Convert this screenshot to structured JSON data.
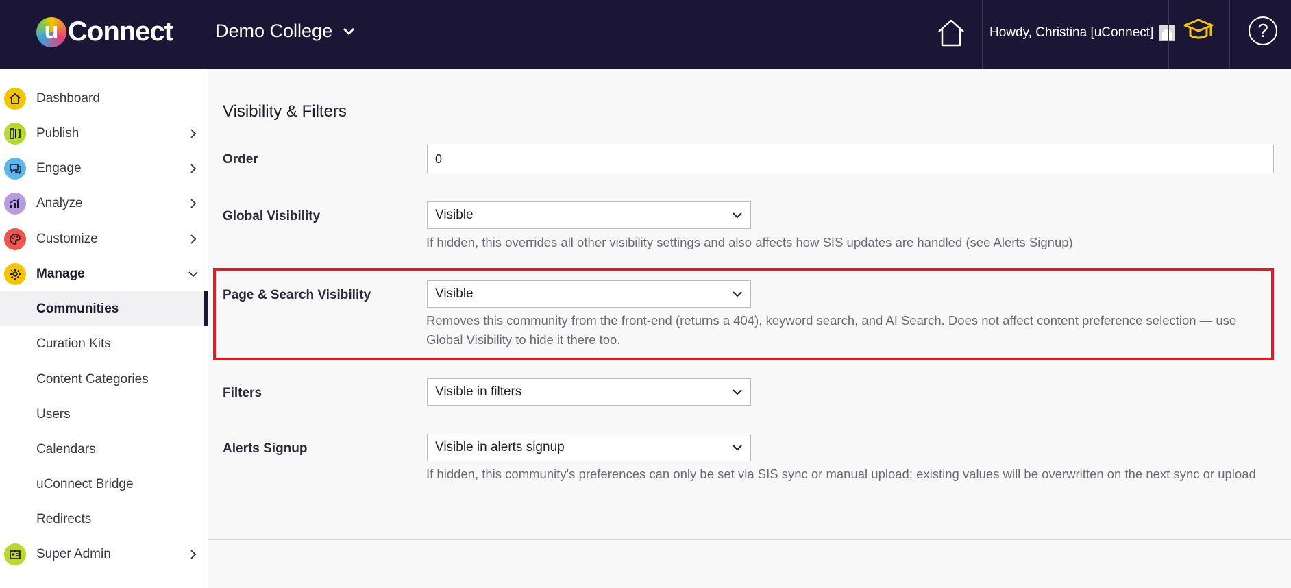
{
  "header": {
    "logo_u": "u",
    "logo_text": "Connect",
    "college": "Demo College",
    "greeting": "Howdy, Christina [uConnect]"
  },
  "sidebar": {
    "items": [
      {
        "label": "Dashboard",
        "icon": "home-icon",
        "color": "#f5c400"
      },
      {
        "label": "Publish",
        "icon": "publish-icon",
        "color": "#b8d92e"
      },
      {
        "label": "Engage",
        "icon": "chat-icon",
        "color": "#5bb8ec"
      },
      {
        "label": "Analyze",
        "icon": "chart-icon",
        "color": "#b89be0"
      },
      {
        "label": "Customize",
        "icon": "palette-icon",
        "color": "#f0554c"
      },
      {
        "label": "Manage",
        "icon": "gear-icon",
        "color": "#f5c400"
      }
    ],
    "sub_items": [
      {
        "label": "Communities"
      },
      {
        "label": "Curation Kits"
      },
      {
        "label": "Content Categories"
      },
      {
        "label": "Users"
      },
      {
        "label": "Calendars"
      },
      {
        "label": "uConnect Bridge"
      },
      {
        "label": "Redirects"
      }
    ],
    "super_admin": {
      "label": "Super Admin",
      "icon": "id-badge-icon",
      "color": "#b8d92e"
    }
  },
  "main": {
    "title": "Visibility & Filters",
    "order": {
      "label": "Order",
      "value": "0"
    },
    "global_visibility": {
      "label": "Global Visibility",
      "value": "Visible",
      "help": "If hidden, this overrides all other visibility settings and also affects how SIS updates are handled (see Alerts Signup)"
    },
    "page_search_visibility": {
      "label": "Page & Search Visibility",
      "value": "Visible",
      "help_line1": "Removes this community from the front-end (returns a 404), keyword search, and AI Search. Does not affect content preference selection — use",
      "help_line2": "Global Visibility to hide it there too."
    },
    "filters": {
      "label": "Filters",
      "value": "Visible in filters"
    },
    "alerts_signup": {
      "label": "Alerts Signup",
      "value": "Visible in alerts signup",
      "help": "If hidden, this community's preferences can only be set via SIS sync or manual upload; existing values will be overwritten on the next sync or upload"
    }
  },
  "colors": {
    "topbar": "#1b1536",
    "highlight": "#e11d24",
    "cap_icon": "#f5c400"
  }
}
